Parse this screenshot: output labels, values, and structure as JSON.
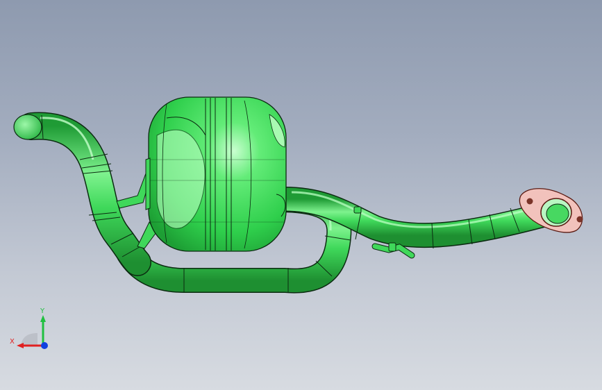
{
  "viewport": {
    "model_color": "#3fd85a",
    "edge_color": "#0b2a10",
    "flange_color": "#f2c2bc"
  },
  "triad": {
    "x_label": "X",
    "y_label": "Y",
    "x_color": "#e02020",
    "y_color": "#20c040",
    "z_color": "#1040e0"
  }
}
